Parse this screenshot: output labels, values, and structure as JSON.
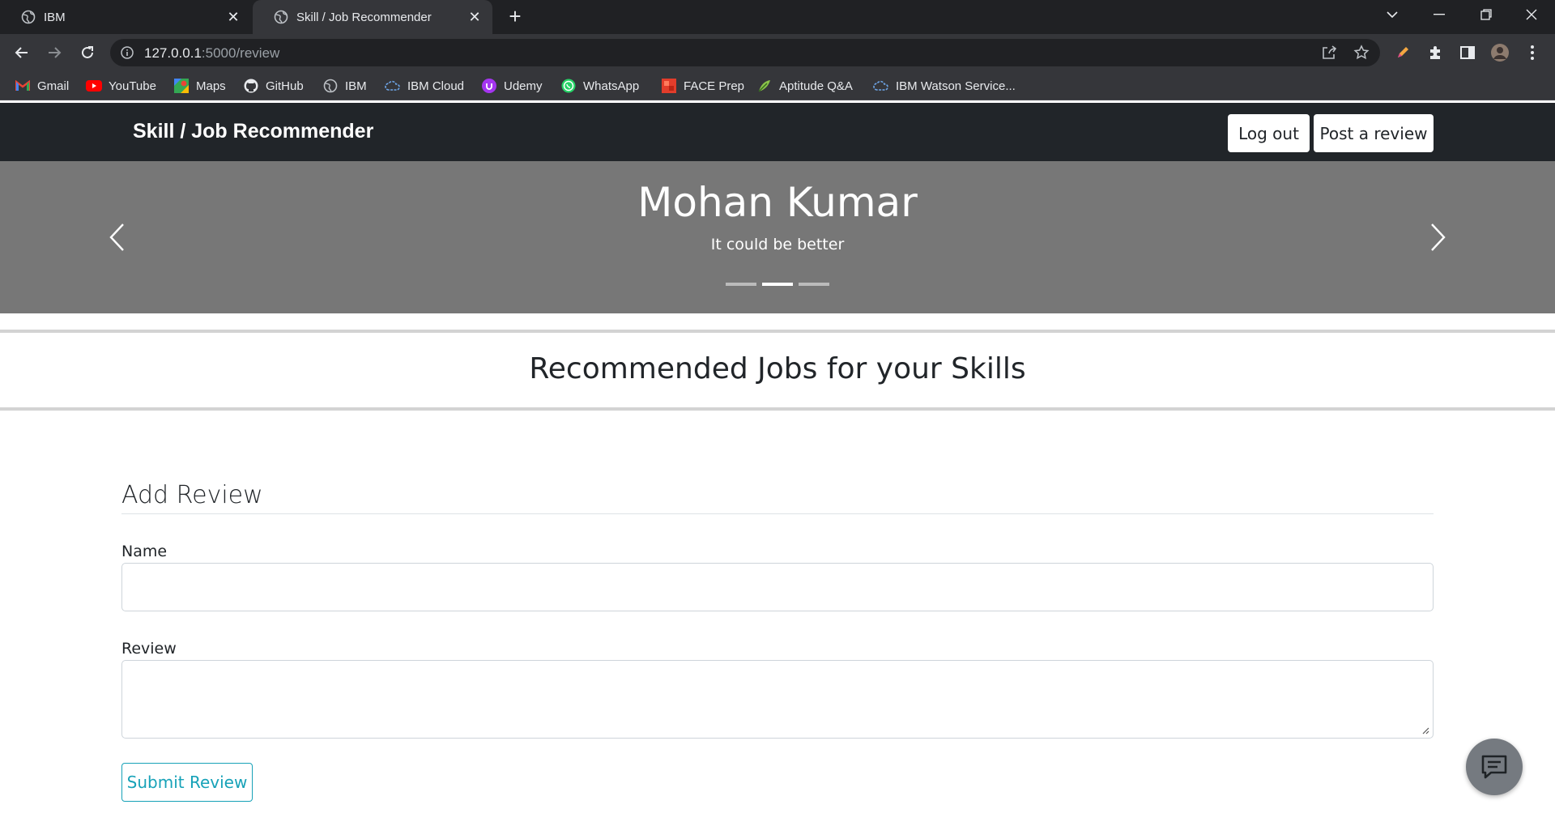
{
  "browser": {
    "tabs": [
      {
        "title": "IBM",
        "active": false
      },
      {
        "title": "Skill / Job Recommender",
        "active": true
      }
    ],
    "url_host": "127.0.0.1",
    "url_path": ":5000/review",
    "bookmarks": [
      {
        "label": "Gmail",
        "icon": "gmail-icon"
      },
      {
        "label": "YouTube",
        "icon": "youtube-icon"
      },
      {
        "label": "Maps",
        "icon": "maps-icon"
      },
      {
        "label": "GitHub",
        "icon": "github-icon"
      },
      {
        "label": "IBM",
        "icon": "globe-icon"
      },
      {
        "label": "IBM Cloud",
        "icon": "ibm-cloud-icon"
      },
      {
        "label": "Udemy",
        "icon": "udemy-icon"
      },
      {
        "label": "WhatsApp",
        "icon": "whatsapp-icon"
      },
      {
        "label": "FACE Prep",
        "icon": "face-prep-icon"
      },
      {
        "label": "Aptitude Q&A",
        "icon": "aptitude-icon"
      },
      {
        "label": "IBM Watson Service...",
        "icon": "ibm-watson-icon"
      }
    ]
  },
  "navbar": {
    "brand": "Skill / Job Recommender",
    "logout_label": "Log out",
    "post_review_label": "Post a review"
  },
  "carousel": {
    "name": "Mohan Kumar",
    "quote": "It could be better",
    "active_slide": 2,
    "slide_count": 3
  },
  "main": {
    "section_title": "Recommended Jobs for your Skills"
  },
  "form": {
    "title": "Add Review",
    "name_label": "Name",
    "name_value": "",
    "review_label": "Review",
    "review_value": "",
    "submit_label": "Submit Review"
  },
  "colors": {
    "navbar_bg": "#212529",
    "carousel_bg": "#777777",
    "submit_accent": "#17a2b8",
    "chrome_dark": "#202124",
    "chrome_toolbar": "#35363a"
  }
}
